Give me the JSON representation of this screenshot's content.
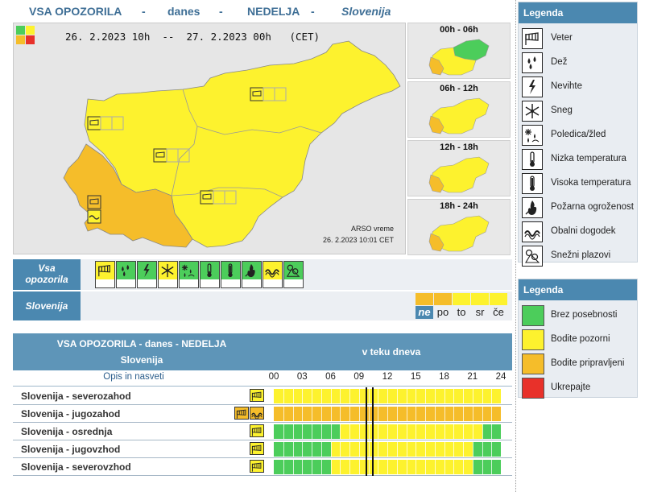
{
  "header": {
    "title": "VSA OPOZORILA",
    "sep1": "-",
    "day": "danes",
    "sep2": "-",
    "weekday": "NEDELJA",
    "sep3": "-",
    "region": "Slovenija"
  },
  "map": {
    "date_range": "26. 2.2023 10h  --  27. 2.2023 00h   (CET)",
    "credit_line1": "ARSO vreme",
    "credit_line2": "26. 2.2023  10:01 CET",
    "legend_colors": [
      "#4ccd5b",
      "#fdf22e",
      "#f5bd2a",
      "#e8312a"
    ]
  },
  "mini_maps": [
    {
      "label": "00h - 06h"
    },
    {
      "label": "06h - 12h"
    },
    {
      "label": "12h - 18h"
    },
    {
      "label": "18h - 24h"
    }
  ],
  "warnings_row": {
    "label_line1": "Vsa",
    "label_line2": "opozorila",
    "icons": [
      {
        "icon": "wind-icon",
        "level": "yellow"
      },
      {
        "icon": "rain-icon",
        "level": "green"
      },
      {
        "icon": "thunderstorm-icon",
        "level": "green"
      },
      {
        "icon": "snow-icon",
        "level": "yellow"
      },
      {
        "icon": "ice-icon",
        "level": "green"
      },
      {
        "icon": "low-temperature-icon",
        "level": "green"
      },
      {
        "icon": "high-temperature-icon",
        "level": "green"
      },
      {
        "icon": "fire-danger-icon",
        "level": "green"
      },
      {
        "icon": "coastal-event-icon",
        "level": "yellow"
      },
      {
        "icon": "avalanche-icon",
        "level": "green"
      }
    ]
  },
  "region_row": {
    "label": "Slovenija",
    "days": [
      {
        "label": "ne",
        "color": "#f5bd2a",
        "selected": true
      },
      {
        "label": "po",
        "color": "#f5bd2a",
        "selected": false
      },
      {
        "label": "to",
        "color": "#fdf22e",
        "selected": false
      },
      {
        "label": "sr",
        "color": "#fdf22e",
        "selected": false
      },
      {
        "label": "če",
        "color": "#fdf22e",
        "selected": false
      }
    ]
  },
  "table": {
    "title_line1": "VSA OPOZORILA - danes - NEDELJA",
    "title_line2": "Slovenija",
    "right_title": "v teku dneva",
    "opis": "Opis in nasveti",
    "hours": [
      "00",
      "03",
      "06",
      "09",
      "12",
      "15",
      "18",
      "21",
      "24"
    ],
    "now_hours": [
      9.75,
      10.5
    ],
    "rows": [
      {
        "name": "Slovenija - severozahod",
        "icons": [
          "wind-icon"
        ],
        "segments": [
          {
            "from": 0,
            "to": 24,
            "level": "yellow"
          }
        ]
      },
      {
        "name": "Slovenija - jugozahod",
        "icons": [
          "wind-icon",
          "coastal-event-icon"
        ],
        "segments": [
          {
            "from": 0,
            "to": 24,
            "level": "orange"
          }
        ]
      },
      {
        "name": "Slovenija - osrednja",
        "icons": [
          "wind-icon"
        ],
        "segments": [
          {
            "from": 0,
            "to": 7,
            "level": "green"
          },
          {
            "from": 7,
            "to": 22,
            "level": "yellow"
          },
          {
            "from": 22,
            "to": 24,
            "level": "green"
          }
        ]
      },
      {
        "name": "Slovenija - jugovzhod",
        "icons": [
          "wind-icon"
        ],
        "segments": [
          {
            "from": 0,
            "to": 6,
            "level": "green"
          },
          {
            "from": 6,
            "to": 21,
            "level": "yellow"
          },
          {
            "from": 21,
            "to": 24,
            "level": "green"
          }
        ]
      },
      {
        "name": "Slovenija - severovzhod",
        "icons": [
          "wind-icon"
        ],
        "segments": [
          {
            "from": 0,
            "to": 6,
            "level": "green"
          },
          {
            "from": 6,
            "to": 21,
            "level": "yellow"
          },
          {
            "from": 21,
            "to": 24,
            "level": "green"
          }
        ]
      }
    ]
  },
  "legend1": {
    "title": "Legenda",
    "items": [
      {
        "icon": "wind-icon",
        "label": "Veter"
      },
      {
        "icon": "rain-icon",
        "label": "Dež"
      },
      {
        "icon": "thunderstorm-icon",
        "label": "Nevihte"
      },
      {
        "icon": "snow-icon",
        "label": "Sneg"
      },
      {
        "icon": "ice-icon",
        "label": "Poledica/žled"
      },
      {
        "icon": "low-temperature-icon",
        "label": "Nizka temperatura"
      },
      {
        "icon": "high-temperature-icon",
        "label": "Visoka temperatura"
      },
      {
        "icon": "fire-danger-icon",
        "label": "Požarna ogroženost"
      },
      {
        "icon": "coastal-event-icon",
        "label": "Obalni dogodek"
      },
      {
        "icon": "avalanche-icon",
        "label": "Snežni plazovi"
      }
    ]
  },
  "legend2": {
    "title": "Legenda",
    "items": [
      {
        "color": "#4ccd5b",
        "label": "Brez posebnosti"
      },
      {
        "color": "#fdf22e",
        "label": "Bodite pozorni"
      },
      {
        "color": "#f5bd2a",
        "label": "Bodite pripravljeni"
      },
      {
        "color": "#e8312a",
        "label": "Ukrepajte"
      }
    ]
  },
  "colors": {
    "green": "#4ccd5b",
    "yellow": "#fdf22e",
    "orange": "#f5bd2a",
    "red": "#e8312a",
    "accent": "#4b88b0"
  }
}
